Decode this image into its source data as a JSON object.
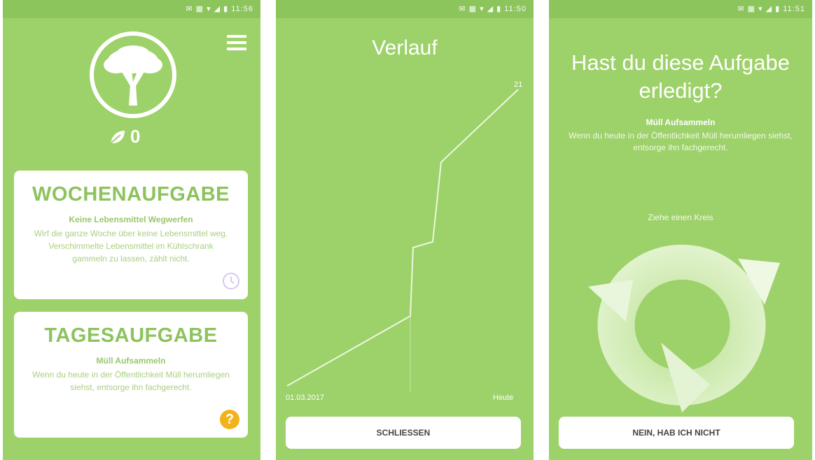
{
  "screen1": {
    "leaf_count": "0",
    "weekly": {
      "heading": "WOCHENAUFGABE",
      "task_title": "Keine Lebensmittel Wegwerfen",
      "task_desc": "Wirf die ganze Woche über keine Lebensmittel weg. Verschimmelte Lebensmittel im Kühlschrank gammeln zu lassen, zählt nicht."
    },
    "daily": {
      "heading": "TAGESAUFGABE",
      "task_title": "Müll Aufsammeln",
      "task_desc": "Wenn du heute in der Öffentlichkeit Müll herumliegen siehst, entsorge ihn fachgerecht.",
      "help_glyph": "?"
    },
    "icons": [
      "menu-icon",
      "tree-icon",
      "leaf-icon",
      "clock-icon",
      "help-icon"
    ]
  },
  "screen2": {
    "title": "Verlauf",
    "start_date": "01.03.2017",
    "end_label": "Heute",
    "max_label": "21",
    "close_button": "SCHLIESSEN"
  },
  "screen3": {
    "question": "Hast du diese Aufgabe erledigt?",
    "task_title": "Müll Aufsammeln",
    "task_desc": "Wenn du heute in der Öffentlichkeit Müll herumliegen siehst, entsorge ihn fachgerecht.",
    "hint": "Ziehe einen Kreis",
    "no_button": "NEIN, HAB ICH NICHT"
  },
  "colors": {
    "background_green": "#9dd16a",
    "card_white": "#ffffff",
    "heading_green": "#8dc35d",
    "help_orange": "#f4b21a"
  }
}
